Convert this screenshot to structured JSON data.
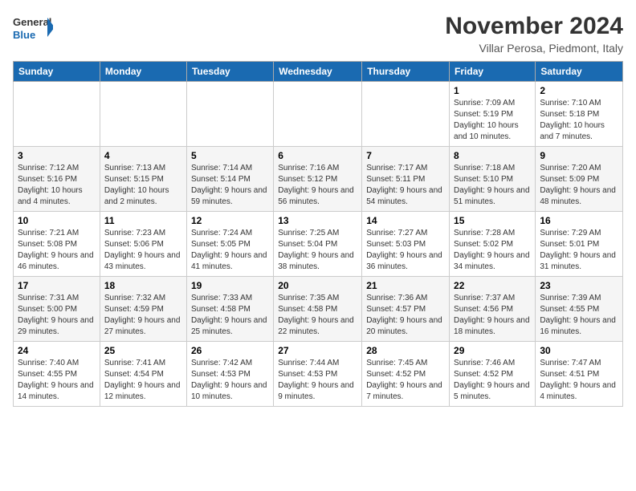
{
  "logo": {
    "line1": "General",
    "line2": "Blue"
  },
  "title": "November 2024",
  "location": "Villar Perosa, Piedmont, Italy",
  "weekdays": [
    "Sunday",
    "Monday",
    "Tuesday",
    "Wednesday",
    "Thursday",
    "Friday",
    "Saturday"
  ],
  "rows": [
    [
      {
        "day": "",
        "info": ""
      },
      {
        "day": "",
        "info": ""
      },
      {
        "day": "",
        "info": ""
      },
      {
        "day": "",
        "info": ""
      },
      {
        "day": "",
        "info": ""
      },
      {
        "day": "1",
        "info": "Sunrise: 7:09 AM\nSunset: 5:19 PM\nDaylight: 10 hours and 10 minutes."
      },
      {
        "day": "2",
        "info": "Sunrise: 7:10 AM\nSunset: 5:18 PM\nDaylight: 10 hours and 7 minutes."
      }
    ],
    [
      {
        "day": "3",
        "info": "Sunrise: 7:12 AM\nSunset: 5:16 PM\nDaylight: 10 hours and 4 minutes."
      },
      {
        "day": "4",
        "info": "Sunrise: 7:13 AM\nSunset: 5:15 PM\nDaylight: 10 hours and 2 minutes."
      },
      {
        "day": "5",
        "info": "Sunrise: 7:14 AM\nSunset: 5:14 PM\nDaylight: 9 hours and 59 minutes."
      },
      {
        "day": "6",
        "info": "Sunrise: 7:16 AM\nSunset: 5:12 PM\nDaylight: 9 hours and 56 minutes."
      },
      {
        "day": "7",
        "info": "Sunrise: 7:17 AM\nSunset: 5:11 PM\nDaylight: 9 hours and 54 minutes."
      },
      {
        "day": "8",
        "info": "Sunrise: 7:18 AM\nSunset: 5:10 PM\nDaylight: 9 hours and 51 minutes."
      },
      {
        "day": "9",
        "info": "Sunrise: 7:20 AM\nSunset: 5:09 PM\nDaylight: 9 hours and 48 minutes."
      }
    ],
    [
      {
        "day": "10",
        "info": "Sunrise: 7:21 AM\nSunset: 5:08 PM\nDaylight: 9 hours and 46 minutes."
      },
      {
        "day": "11",
        "info": "Sunrise: 7:23 AM\nSunset: 5:06 PM\nDaylight: 9 hours and 43 minutes."
      },
      {
        "day": "12",
        "info": "Sunrise: 7:24 AM\nSunset: 5:05 PM\nDaylight: 9 hours and 41 minutes."
      },
      {
        "day": "13",
        "info": "Sunrise: 7:25 AM\nSunset: 5:04 PM\nDaylight: 9 hours and 38 minutes."
      },
      {
        "day": "14",
        "info": "Sunrise: 7:27 AM\nSunset: 5:03 PM\nDaylight: 9 hours and 36 minutes."
      },
      {
        "day": "15",
        "info": "Sunrise: 7:28 AM\nSunset: 5:02 PM\nDaylight: 9 hours and 34 minutes."
      },
      {
        "day": "16",
        "info": "Sunrise: 7:29 AM\nSunset: 5:01 PM\nDaylight: 9 hours and 31 minutes."
      }
    ],
    [
      {
        "day": "17",
        "info": "Sunrise: 7:31 AM\nSunset: 5:00 PM\nDaylight: 9 hours and 29 minutes."
      },
      {
        "day": "18",
        "info": "Sunrise: 7:32 AM\nSunset: 4:59 PM\nDaylight: 9 hours and 27 minutes."
      },
      {
        "day": "19",
        "info": "Sunrise: 7:33 AM\nSunset: 4:58 PM\nDaylight: 9 hours and 25 minutes."
      },
      {
        "day": "20",
        "info": "Sunrise: 7:35 AM\nSunset: 4:58 PM\nDaylight: 9 hours and 22 minutes."
      },
      {
        "day": "21",
        "info": "Sunrise: 7:36 AM\nSunset: 4:57 PM\nDaylight: 9 hours and 20 minutes."
      },
      {
        "day": "22",
        "info": "Sunrise: 7:37 AM\nSunset: 4:56 PM\nDaylight: 9 hours and 18 minutes."
      },
      {
        "day": "23",
        "info": "Sunrise: 7:39 AM\nSunset: 4:55 PM\nDaylight: 9 hours and 16 minutes."
      }
    ],
    [
      {
        "day": "24",
        "info": "Sunrise: 7:40 AM\nSunset: 4:55 PM\nDaylight: 9 hours and 14 minutes."
      },
      {
        "day": "25",
        "info": "Sunrise: 7:41 AM\nSunset: 4:54 PM\nDaylight: 9 hours and 12 minutes."
      },
      {
        "day": "26",
        "info": "Sunrise: 7:42 AM\nSunset: 4:53 PM\nDaylight: 9 hours and 10 minutes."
      },
      {
        "day": "27",
        "info": "Sunrise: 7:44 AM\nSunset: 4:53 PM\nDaylight: 9 hours and 9 minutes."
      },
      {
        "day": "28",
        "info": "Sunrise: 7:45 AM\nSunset: 4:52 PM\nDaylight: 9 hours and 7 minutes."
      },
      {
        "day": "29",
        "info": "Sunrise: 7:46 AM\nSunset: 4:52 PM\nDaylight: 9 hours and 5 minutes."
      },
      {
        "day": "30",
        "info": "Sunrise: 7:47 AM\nSunset: 4:51 PM\nDaylight: 9 hours and 4 minutes."
      }
    ]
  ]
}
